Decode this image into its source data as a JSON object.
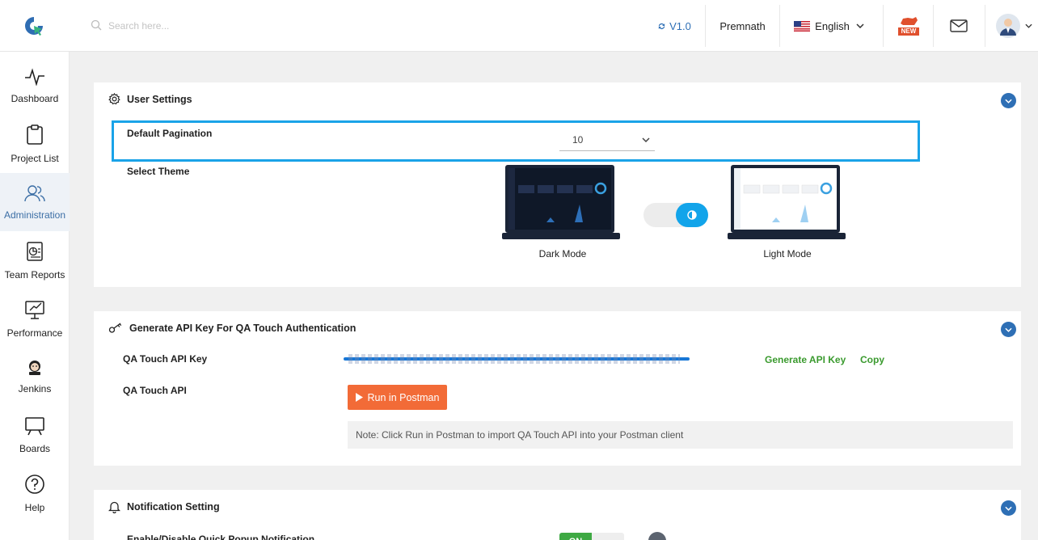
{
  "header": {
    "search_placeholder": "Search here...",
    "version": "V1.0",
    "user_name": "Premnath",
    "language": "English",
    "new_badge": "NEW"
  },
  "sidebar": {
    "items": [
      {
        "label": "Dashboard",
        "icon": "activity-icon"
      },
      {
        "label": "Project List",
        "icon": "clipboard-icon"
      },
      {
        "label": "Administration",
        "icon": "users-icon",
        "active": true
      },
      {
        "label": "Team Reports",
        "icon": "report-icon"
      },
      {
        "label": "Performance",
        "icon": "performance-icon"
      },
      {
        "label": "Jenkins",
        "icon": "jenkins-icon"
      },
      {
        "label": "Boards",
        "icon": "board-icon"
      },
      {
        "label": "Help",
        "icon": "help-icon"
      }
    ]
  },
  "user_settings": {
    "title": "User Settings",
    "pagination_label": "Default Pagination",
    "pagination_value": "10",
    "theme_label": "Select Theme",
    "dark_mode": "Dark Mode",
    "light_mode": "Light Mode"
  },
  "api_key": {
    "title": "Generate API Key For QA Touch Authentication",
    "key_label": "QA Touch API Key",
    "api_label": "QA Touch API",
    "generate_label": "Generate API Key",
    "copy_label": "Copy",
    "postman_label": "Run in Postman",
    "note": "Note: Click Run in Postman to import QA Touch API into your Postman client"
  },
  "notification": {
    "title": "Notification Setting",
    "quick_popup_label": "Enable/Disable Quick Popup Notification",
    "toggle_on": "ON"
  },
  "colors": {
    "accent": "#2e6fb5",
    "highlight_border": "#1aa3e8",
    "green": "#3a9a2e",
    "postman": "#f26b37"
  }
}
